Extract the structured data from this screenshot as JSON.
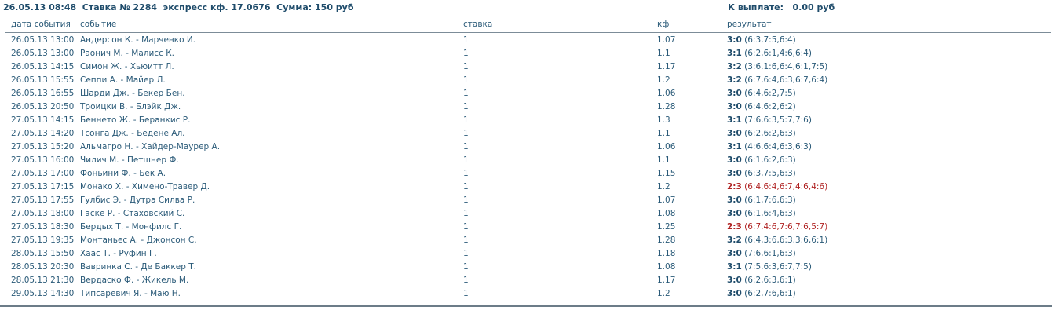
{
  "header": {
    "info": "26.05.13 08:48  Ставка № 2284  экспресс кф. 17.0676  Сумма: 150 руб",
    "payout": "К выплате:   0.00 руб"
  },
  "columns": {
    "date": "дата события",
    "event": "событие",
    "stake": "ставка",
    "kf": "кф",
    "result": "результат"
  },
  "rows": [
    {
      "date": "26.05.13 13:00",
      "event": "Андерсон К. - Марченко И.",
      "stake": "1",
      "kf": "1.07",
      "score": "3:0",
      "sets": "(6:3,7:5,6:4)",
      "status": "win"
    },
    {
      "date": "26.05.13 13:00",
      "event": "Раонич М. - Малисс К.",
      "stake": "1",
      "kf": "1.1",
      "score": "3:1",
      "sets": "(6:2,6:1,4:6,6:4)",
      "status": "win"
    },
    {
      "date": "26.05.13 14:15",
      "event": "Симон Ж. - Хьюитт Л.",
      "stake": "1",
      "kf": "1.17",
      "score": "3:2",
      "sets": "(3:6,1:6,6:4,6:1,7:5)",
      "status": "win"
    },
    {
      "date": "26.05.13 15:55",
      "event": "Сеппи А. - Майер Л.",
      "stake": "1",
      "kf": "1.2",
      "score": "3:2",
      "sets": "(6:7,6:4,6:3,6:7,6:4)",
      "status": "win"
    },
    {
      "date": "26.05.13 16:55",
      "event": "Шарди Дж. - Бекер Бен.",
      "stake": "1",
      "kf": "1.06",
      "score": "3:0",
      "sets": "(6:4,6:2,7:5)",
      "status": "win"
    },
    {
      "date": "26.05.13 20:50",
      "event": "Троицки В. - Блэйк Дж.",
      "stake": "1",
      "kf": "1.28",
      "score": "3:0",
      "sets": "(6:4,6:2,6:2)",
      "status": "win"
    },
    {
      "date": "27.05.13 14:15",
      "event": "Беннето Ж. - Беранкис Р.",
      "stake": "1",
      "kf": "1.3",
      "score": "3:1",
      "sets": "(7:6,6:3,5:7,7:6)",
      "status": "win"
    },
    {
      "date": "27.05.13 14:20",
      "event": "Тсонга Дж. - Бедене Ал.",
      "stake": "1",
      "kf": "1.1",
      "score": "3:0",
      "sets": "(6:2,6:2,6:3)",
      "status": "win"
    },
    {
      "date": "27.05.13 15:20",
      "event": "Альмагро Н. - Хайдер-Маурер А.",
      "stake": "1",
      "kf": "1.06",
      "score": "3:1",
      "sets": "(4:6,6:4,6:3,6:3)",
      "status": "win"
    },
    {
      "date": "27.05.13 16:00",
      "event": "Чилич М. - Петшнер Ф.",
      "stake": "1",
      "kf": "1.1",
      "score": "3:0",
      "sets": "(6:1,6:2,6:3)",
      "status": "win"
    },
    {
      "date": "27.05.13 17:00",
      "event": "Фоньини Ф. - Бек А.",
      "stake": "1",
      "kf": "1.15",
      "score": "3:0",
      "sets": "(6:3,7:5,6:3)",
      "status": "win"
    },
    {
      "date": "27.05.13 17:15",
      "event": "Монако Х. - Химено-Травер Д.",
      "stake": "1",
      "kf": "1.2",
      "score": "2:3",
      "sets": "(6:4,6:4,6:7,4:6,4:6)",
      "status": "loss"
    },
    {
      "date": "27.05.13 17:55",
      "event": "Гулбис Э. - Дутра Силва Р.",
      "stake": "1",
      "kf": "1.07",
      "score": "3:0",
      "sets": "(6:1,7:6,6:3)",
      "status": "win"
    },
    {
      "date": "27.05.13 18:00",
      "event": "Гаске Р. - Стаховский С.",
      "stake": "1",
      "kf": "1.08",
      "score": "3:0",
      "sets": "(6:1,6:4,6:3)",
      "status": "win"
    },
    {
      "date": "27.05.13 18:30",
      "event": "Бердых Т. - Монфилс Г.",
      "stake": "1",
      "kf": "1.25",
      "score": "2:3",
      "sets": "(6:7,4:6,7:6,7:6,5:7)",
      "status": "loss"
    },
    {
      "date": "27.05.13 19:35",
      "event": "Монтаньес А. - Джонсон С.",
      "stake": "1",
      "kf": "1.28",
      "score": "3:2",
      "sets": "(6:4,3:6,6:3,3:6,6:1)",
      "status": "win"
    },
    {
      "date": "28.05.13 15:50",
      "event": "Хаас Т. - Руфин Г.",
      "stake": "1",
      "kf": "1.18",
      "score": "3:0",
      "sets": "(7:6,6:1,6:3)",
      "status": "win"
    },
    {
      "date": "28.05.13 20:30",
      "event": "Вавринка С. - Де Баккер Т.",
      "stake": "1",
      "kf": "1.08",
      "score": "3:1",
      "sets": "(7:5,6:3,6:7,7:5)",
      "status": "win"
    },
    {
      "date": "28.05.13 21:30",
      "event": "Вердаско Ф. - Жикель М.",
      "stake": "1",
      "kf": "1.17",
      "score": "3:0",
      "sets": "(6:2,6:3,6:1)",
      "status": "win"
    },
    {
      "date": "29.05.13 14:30",
      "event": "Типсаревич Я. - Маю Н.",
      "stake": "1",
      "kf": "1.2",
      "score": "3:0",
      "sets": "(6:2,7:6,6:1)",
      "status": "win"
    }
  ],
  "colors": {
    "text": "#2a5a78",
    "header": "#1f4c6b",
    "loss": "#b02323"
  }
}
